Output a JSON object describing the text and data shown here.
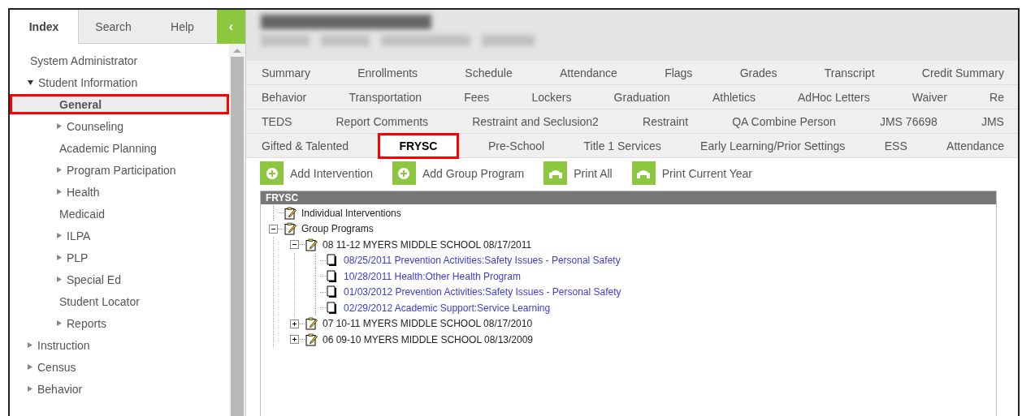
{
  "sidebar": {
    "tabs": [
      {
        "label": "Index",
        "selected": true
      },
      {
        "label": "Search",
        "selected": false
      },
      {
        "label": "Help",
        "selected": false
      }
    ],
    "collapse_button": "‹",
    "items": [
      {
        "label": "System Administrator",
        "selected": false
      },
      {
        "label": "Student Information",
        "selected": false,
        "expanded": true,
        "children": [
          {
            "label": "General",
            "selected": true
          },
          {
            "label": "Counseling",
            "selected": false,
            "expanded": false
          },
          {
            "label": "Academic Planning",
            "selected": false
          },
          {
            "label": "Program Participation",
            "selected": false,
            "expanded": false
          },
          {
            "label": "Health",
            "selected": false,
            "expanded": false
          },
          {
            "label": "Medicaid",
            "selected": false
          },
          {
            "label": "ILPA",
            "selected": false,
            "expanded": false
          },
          {
            "label": "PLP",
            "selected": false,
            "expanded": false
          },
          {
            "label": "Special Ed",
            "selected": false,
            "expanded": false
          },
          {
            "label": "Student Locator",
            "selected": false
          },
          {
            "label": "Reports",
            "selected": false,
            "expanded": false
          }
        ]
      },
      {
        "label": "Instruction",
        "selected": false,
        "expanded": false
      },
      {
        "label": "Census",
        "selected": false,
        "expanded": false
      },
      {
        "label": "Behavior",
        "selected": false,
        "expanded": false
      }
    ]
  },
  "tab_rows": [
    [
      {
        "label": "Summary",
        "selected": false
      },
      {
        "label": "Enrollments",
        "selected": false
      },
      {
        "label": "Schedule",
        "selected": false
      },
      {
        "label": "Attendance",
        "selected": false
      },
      {
        "label": "Flags",
        "selected": false
      },
      {
        "label": "Grades",
        "selected": false
      },
      {
        "label": "Transcript",
        "selected": false
      },
      {
        "label": "Credit Summary",
        "selected": false
      }
    ],
    [
      {
        "label": "Behavior",
        "selected": false
      },
      {
        "label": "Transportation",
        "selected": false
      },
      {
        "label": "Fees",
        "selected": false
      },
      {
        "label": "Lockers",
        "selected": false
      },
      {
        "label": "Graduation",
        "selected": false
      },
      {
        "label": "Athletics",
        "selected": false
      },
      {
        "label": "AdHoc Letters",
        "selected": false
      },
      {
        "label": "Waiver",
        "selected": false
      },
      {
        "label": "Re",
        "selected": false
      }
    ],
    [
      {
        "label": "TEDS",
        "selected": false
      },
      {
        "label": "Report Comments",
        "selected": false
      },
      {
        "label": "Restraint and Seclusion2",
        "selected": false
      },
      {
        "label": "Restraint",
        "selected": false
      },
      {
        "label": "QA Combine Person",
        "selected": false
      },
      {
        "label": "JMS 76698",
        "selected": false
      },
      {
        "label": "JMS",
        "selected": false
      }
    ],
    [
      {
        "label": "Gifted & Talented",
        "selected": false
      },
      {
        "label": "FRYSC",
        "selected": true
      },
      {
        "label": "Pre-School",
        "selected": false
      },
      {
        "label": "Title 1 Services",
        "selected": false
      },
      {
        "label": "Early Learning/Prior Settings",
        "selected": false
      },
      {
        "label": "ESS",
        "selected": false
      },
      {
        "label": "Attendance",
        "selected": false
      }
    ]
  ],
  "toolbar": [
    {
      "label": "Add Intervention",
      "kind": "add"
    },
    {
      "label": "Add Group Program",
      "kind": "add"
    },
    {
      "label": "Print All",
      "kind": "print"
    },
    {
      "label": "Print Current Year",
      "kind": "print"
    }
  ],
  "tree": {
    "title": "FRYSC",
    "nodes": [
      {
        "label": "Individual Interventions",
        "kind": "folder"
      },
      {
        "label": "Group Programs",
        "kind": "folder",
        "expanded": true,
        "children": [
          {
            "label": "08 11-12 MYERS MIDDLE SCHOOL 08/17/2011",
            "kind": "folder",
            "expanded": true,
            "children": [
              {
                "label": "08/25/2011 Prevention Activities:Safety Issues - Personal Safety",
                "kind": "record"
              },
              {
                "label": "10/28/2011 Health:Other Health Program",
                "kind": "record"
              },
              {
                "label": "01/03/2012 Prevention Activities:Safety Issues - Personal Safety",
                "kind": "record"
              },
              {
                "label": "02/29/2012 Academic Support:Service Learning",
                "kind": "record"
              }
            ]
          },
          {
            "label": "07 10-11 MYERS MIDDLE SCHOOL 08/17/2010",
            "kind": "folder",
            "expanded": false
          },
          {
            "label": "06 09-10 MYERS MIDDLE SCHOOL 08/13/2009",
            "kind": "folder",
            "expanded": false
          }
        ]
      }
    ]
  }
}
